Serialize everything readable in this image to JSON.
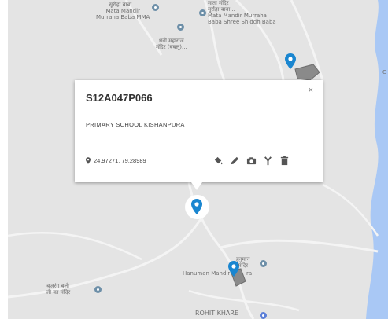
{
  "map": {
    "labels": {
      "top_left_name": "सूरीहा बाबा...",
      "top_left_sub1": "Mata Mandir",
      "top_left_sub2": "Murraha Baba MMA",
      "top_right_name1": "माता मंदिर",
      "top_right_name2": "मुर्राहा बाबा...",
      "top_right_sub1": "Mata Mandir Murraha",
      "top_right_sub2": "Baba Shree Shiddh Baba",
      "mid_name1": "धनी महाराज",
      "mid_name2": "मंदिर (बबलू)...",
      "hanuman_hindi1": "हनुमान",
      "hanuman_hindi2": "मंदिर",
      "hanuman_en": "Hanuman Mandir",
      "hanuman_en_tail": "ra",
      "bajrang1": "बजरंग बली",
      "bajrang2": "जी का मंदिर",
      "rohit": "ROHIT KHARE",
      "edge_letter": "G"
    }
  },
  "popup": {
    "title": "S12A047P066",
    "subtitle": "PRIMARY SCHOOL KISHANPURA",
    "coordinates": "24.97271, 79.28989",
    "close": "×"
  },
  "colors": {
    "pin": "#1a86d0",
    "poi": "#6d8fa8",
    "map_bg": "#e4e4e4",
    "water": "#a9c8f5",
    "polygon": "#8a8a8a"
  },
  "icons": [
    "paint-bucket-icon",
    "pencil-icon",
    "camera-icon",
    "branch-icon",
    "trash-icon"
  ]
}
